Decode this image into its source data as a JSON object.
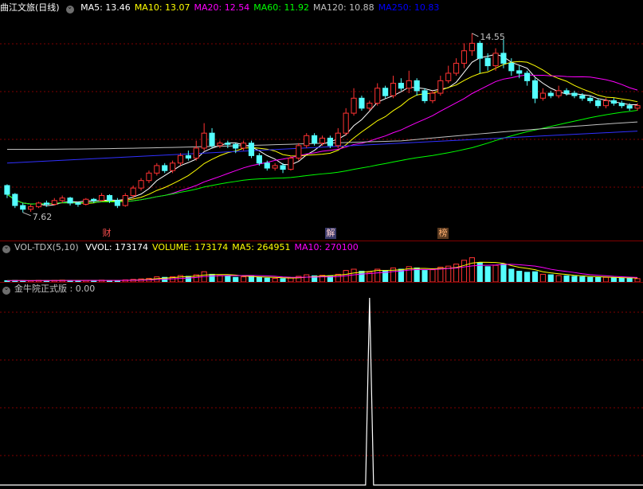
{
  "main": {
    "title": "曲江文旅(日线)",
    "ma_readout": [
      {
        "label": "MA5: 13.46",
        "color": "#ffffff"
      },
      {
        "label": "MA10: 13.07",
        "color": "#ffff00"
      },
      {
        "label": "MA20: 12.54",
        "color": "#ff00ff"
      },
      {
        "label": "MA60: 11.92",
        "color": "#00ff00"
      },
      {
        "label": "MA120: 10.88",
        "color": "#c0c0c0"
      },
      {
        "label": "MA250: 10.83",
        "color": "#0000ff"
      }
    ],
    "high_label": "14.55",
    "low_label": "7.62",
    "markers": [
      "财",
      "解",
      "榜"
    ]
  },
  "vol": {
    "title": "VOL-TDX(5,10)",
    "readout": [
      {
        "label": "VVOL: 173174",
        "color": "#ffffff"
      },
      {
        "label": "VOLUME: 173174",
        "color": "#ffff00"
      },
      {
        "label": "MA5: 264951",
        "color": "#ffff00"
      },
      {
        "label": "MA10: 270100",
        "color": "#ff00ff"
      }
    ]
  },
  "ind": {
    "title": "金牛院正式版 : 0.00"
  },
  "colors": {
    "up": "#ff3232",
    "down": "#54ffff",
    "grid": "#800000"
  },
  "chart_data": {
    "type": "candlestick",
    "ylim": [
      7.2,
      15.4
    ],
    "candles": [
      [
        8.7,
        8.35,
        8.2,
        8.75
      ],
      [
        8.35,
        7.9,
        7.8,
        8.4
      ],
      [
        7.9,
        7.75,
        7.62,
        8.0
      ],
      [
        7.75,
        7.85,
        7.65,
        7.95
      ],
      [
        7.85,
        8.0,
        7.8,
        8.05
      ],
      [
        8.0,
        7.95,
        7.85,
        8.1
      ],
      [
        7.95,
        8.1,
        7.9,
        8.2
      ],
      [
        8.1,
        8.2,
        8.0,
        8.3
      ],
      [
        8.2,
        8.0,
        7.9,
        8.25
      ],
      [
        8.0,
        7.95,
        7.85,
        8.05
      ],
      [
        7.95,
        8.15,
        7.9,
        8.2
      ],
      [
        8.15,
        8.1,
        8.0,
        8.2
      ],
      [
        8.1,
        8.3,
        8.05,
        8.4
      ],
      [
        8.3,
        8.1,
        8.0,
        8.35
      ],
      [
        8.1,
        7.9,
        7.8,
        8.2
      ],
      [
        7.9,
        8.3,
        7.85,
        8.4
      ],
      [
        8.3,
        8.6,
        8.2,
        8.7
      ],
      [
        8.6,
        8.9,
        8.5,
        9.0
      ],
      [
        8.9,
        9.2,
        8.8,
        9.3
      ],
      [
        9.2,
        9.5,
        9.1,
        9.6
      ],
      [
        9.5,
        9.3,
        9.2,
        9.6
      ],
      [
        9.3,
        9.6,
        9.2,
        9.7
      ],
      [
        9.6,
        9.9,
        9.5,
        10.0
      ],
      [
        9.9,
        9.8,
        9.7,
        10.1
      ],
      [
        9.8,
        10.2,
        9.7,
        10.5
      ],
      [
        10.2,
        10.8,
        10.1,
        11.2
      ],
      [
        10.8,
        10.3,
        10.2,
        11.0
      ],
      [
        10.3,
        10.4,
        10.2,
        10.5
      ],
      [
        10.4,
        10.35,
        10.2,
        10.5
      ],
      [
        10.35,
        10.2,
        10.0,
        10.4
      ],
      [
        10.2,
        10.4,
        10.1,
        10.5
      ],
      [
        10.4,
        9.9,
        9.8,
        10.5
      ],
      [
        9.9,
        9.6,
        9.5,
        10.0
      ],
      [
        9.6,
        9.4,
        9.3,
        9.7
      ],
      [
        9.4,
        9.5,
        9.3,
        9.6
      ],
      [
        9.5,
        9.35,
        9.2,
        9.6
      ],
      [
        9.35,
        9.8,
        9.3,
        9.9
      ],
      [
        9.8,
        10.3,
        9.7,
        10.4
      ],
      [
        10.3,
        10.7,
        10.2,
        10.8
      ],
      [
        10.7,
        10.4,
        10.3,
        10.8
      ],
      [
        10.4,
        10.6,
        10.3,
        10.7
      ],
      [
        10.6,
        10.3,
        10.2,
        10.7
      ],
      [
        10.3,
        10.8,
        10.2,
        11.0
      ],
      [
        10.8,
        11.6,
        10.7,
        11.8
      ],
      [
        11.6,
        12.2,
        11.5,
        12.6
      ],
      [
        12.2,
        11.8,
        11.7,
        12.3
      ],
      [
        11.8,
        12.0,
        11.7,
        12.1
      ],
      [
        12.0,
        12.6,
        11.9,
        12.8
      ],
      [
        12.6,
        12.3,
        12.2,
        12.7
      ],
      [
        12.3,
        12.8,
        12.2,
        13.1
      ],
      [
        12.8,
        12.6,
        12.5,
        13.0
      ],
      [
        12.6,
        12.9,
        12.4,
        13.3
      ],
      [
        12.9,
        12.5,
        12.3,
        13.0
      ],
      [
        12.5,
        12.1,
        12.0,
        12.6
      ],
      [
        12.1,
        12.4,
        12.0,
        12.5
      ],
      [
        12.4,
        12.9,
        12.3,
        13.1
      ],
      [
        12.9,
        13.2,
        12.8,
        13.5
      ],
      [
        13.2,
        13.6,
        13.1,
        13.8
      ],
      [
        13.6,
        14.1,
        13.4,
        14.4
      ],
      [
        14.1,
        14.4,
        13.9,
        14.8
      ],
      [
        14.4,
        13.8,
        13.2,
        14.5
      ],
      [
        13.8,
        13.5,
        13.3,
        14.0
      ],
      [
        13.5,
        14.0,
        13.3,
        14.2
      ],
      [
        14.0,
        13.6,
        13.4,
        14.55
      ],
      [
        13.6,
        13.3,
        13.1,
        13.8
      ],
      [
        13.3,
        13.2,
        13.0,
        13.5
      ],
      [
        13.2,
        12.9,
        12.7,
        13.3
      ],
      [
        12.9,
        12.2,
        12.0,
        13.0
      ],
      [
        12.2,
        12.4,
        12.1,
        12.6
      ],
      [
        12.4,
        12.3,
        12.2,
        12.5
      ],
      [
        12.3,
        12.5,
        12.2,
        12.7
      ],
      [
        12.5,
        12.4,
        12.3,
        12.6
      ],
      [
        12.4,
        12.3,
        12.2,
        12.5
      ],
      [
        12.3,
        12.2,
        12.1,
        12.4
      ],
      [
        12.2,
        12.1,
        12.0,
        12.3
      ],
      [
        12.1,
        11.9,
        11.8,
        12.2
      ],
      [
        11.9,
        12.1,
        11.8,
        12.2
      ],
      [
        12.1,
        12.0,
        11.9,
        12.2
      ],
      [
        12.0,
        11.9,
        11.8,
        12.1
      ],
      [
        11.9,
        11.8,
        11.7,
        12.0
      ],
      [
        11.8,
        11.9,
        11.7,
        12.0
      ]
    ],
    "volume": [
      0.05,
      0.06,
      0.05,
      0.05,
      0.06,
      0.05,
      0.06,
      0.07,
      0.06,
      0.05,
      0.06,
      0.06,
      0.07,
      0.06,
      0.05,
      0.08,
      0.1,
      0.12,
      0.14,
      0.2,
      0.18,
      0.2,
      0.25,
      0.22,
      0.28,
      0.4,
      0.3,
      0.25,
      0.22,
      0.18,
      0.2,
      0.22,
      0.18,
      0.15,
      0.14,
      0.13,
      0.16,
      0.22,
      0.28,
      0.24,
      0.26,
      0.24,
      0.3,
      0.45,
      0.5,
      0.42,
      0.38,
      0.5,
      0.45,
      0.55,
      0.5,
      0.6,
      0.55,
      0.45,
      0.48,
      0.58,
      0.62,
      0.7,
      0.85,
      0.95,
      0.75,
      0.6,
      0.65,
      0.7,
      0.5,
      0.42,
      0.38,
      0.4,
      0.3,
      0.28,
      0.25,
      0.24,
      0.22,
      0.2,
      0.18,
      0.17,
      0.18,
      0.16,
      0.15,
      0.14,
      0.13
    ],
    "indicator_spike": {
      "index": 46,
      "value": 1.0
    }
  }
}
